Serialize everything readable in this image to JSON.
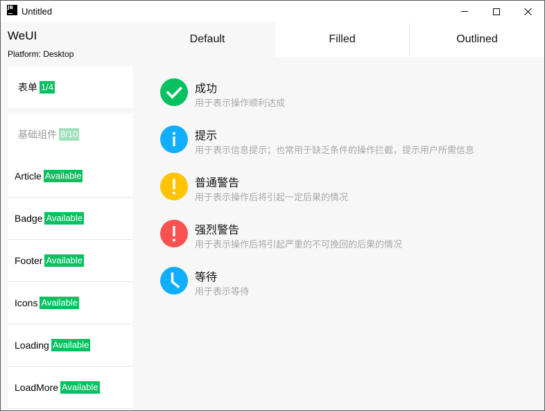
{
  "window": {
    "title": "Untitled",
    "app_icon_text": "JB"
  },
  "sidebar": {
    "brand": "WeUI",
    "platform": "Platform: Desktop",
    "groups": [
      {
        "label": "表单",
        "badge": "1/4"
      },
      {
        "label": "基础组件",
        "badge": "8/10"
      }
    ],
    "components": [
      {
        "label": "Article",
        "badge": "Available"
      },
      {
        "label": "Badge",
        "badge": "Available"
      },
      {
        "label": "Footer",
        "badge": "Available"
      },
      {
        "label": "Icons",
        "badge": "Available"
      },
      {
        "label": "Loading",
        "badge": "Available"
      },
      {
        "label": "LoadMore",
        "badge": "Available"
      }
    ]
  },
  "tabs": [
    {
      "label": "Default",
      "active": true
    },
    {
      "label": "Filled",
      "active": false
    },
    {
      "label": "Outlined",
      "active": false
    }
  ],
  "messages": [
    {
      "icon": "success-icon",
      "color": "#07c160",
      "title": "成功",
      "desc": "用于表示操作顺利达成"
    },
    {
      "icon": "info-icon",
      "color": "#10aeff",
      "title": "提示",
      "desc": "用于表示信息提示；也常用于缺乏条件的操作拦截，提示用户所需信息"
    },
    {
      "icon": "warning-icon",
      "color": "#ffc300",
      "title": "普通警告",
      "desc": "用于表示操作后将引起一定后果的情况"
    },
    {
      "icon": "strong-warning-icon",
      "color": "#fa5151",
      "title": "强烈警告",
      "desc": "用于表示操作后将引起严重的不可挽回的后果的情况"
    },
    {
      "icon": "waiting-icon",
      "color": "#10aeff",
      "title": "等待",
      "desc": "用于表示等待"
    }
  ],
  "colors": {
    "accent": "#07c160",
    "accent_light": "#9fe0bd",
    "background": "#f7f7f7",
    "card": "#ffffff",
    "muted_text": "#a8a8a8"
  }
}
